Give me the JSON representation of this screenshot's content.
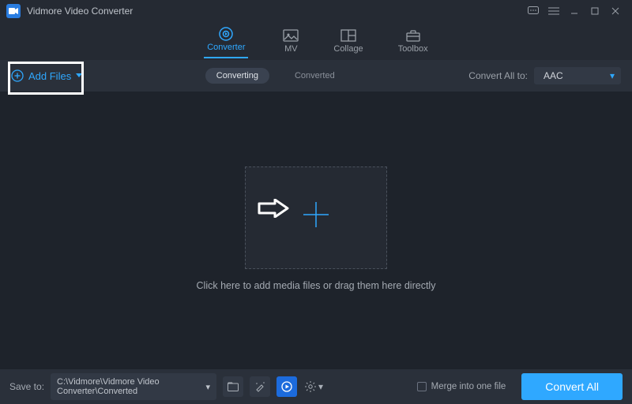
{
  "title": "Vidmore Video Converter",
  "tabs": {
    "converter": "Converter",
    "mv": "MV",
    "collage": "Collage",
    "toolbox": "Toolbox"
  },
  "toolbar": {
    "add_files": "Add Files",
    "converting": "Converting",
    "converted": "Converted",
    "convert_all_to": "Convert All to:",
    "format": "AAC"
  },
  "main": {
    "hint": "Click here to add media files or drag them here directly"
  },
  "footer": {
    "save_to_label": "Save to:",
    "save_path": "C:\\Vidmore\\Vidmore Video Converter\\Converted",
    "merge_label": "Merge into one file",
    "convert_all": "Convert All"
  }
}
